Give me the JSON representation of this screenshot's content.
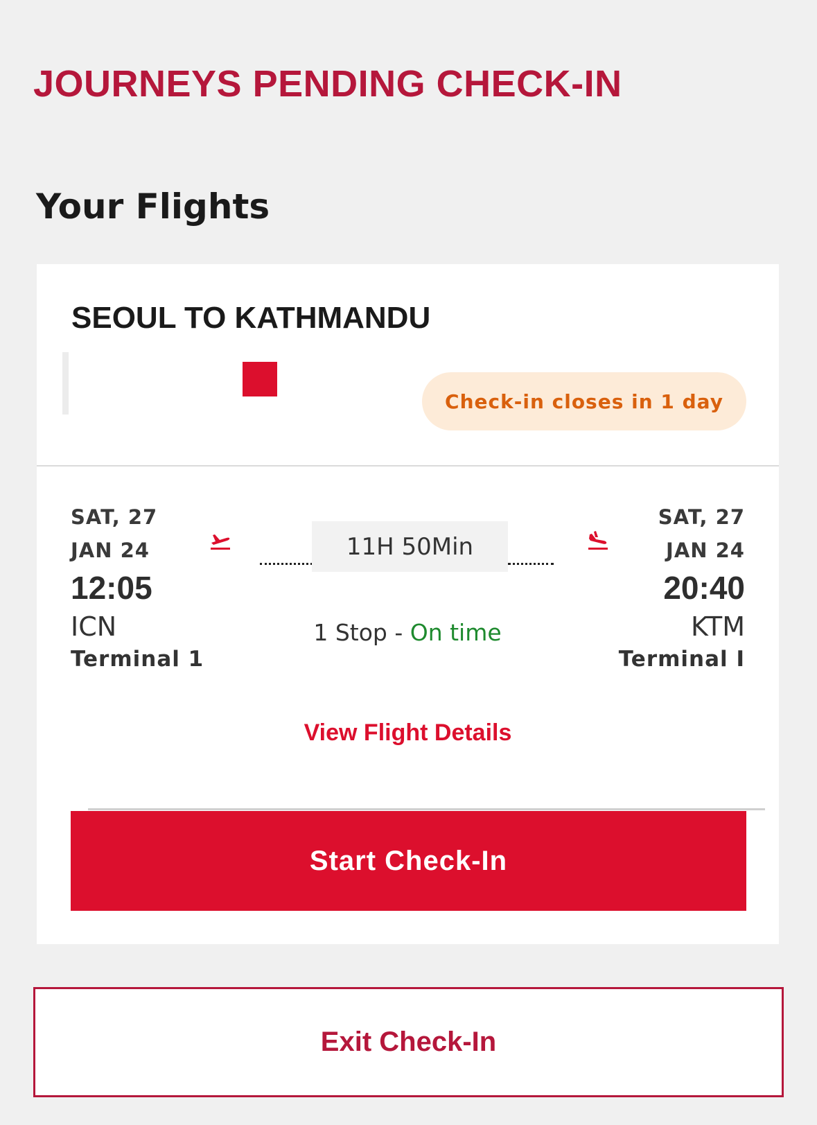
{
  "header": {
    "title": "JOURNEYS PENDING CHECK-IN",
    "section_title": "Your Flights"
  },
  "flight_card": {
    "route": "SEOUL TO KATHMANDU",
    "checkin_badge": "Check-in closes in 1 day",
    "departure": {
      "date_line1": "SAT, 27",
      "date_line2": "JAN 24",
      "time": "12:05",
      "airport": "ICN",
      "terminal": "Terminal 1"
    },
    "arrival": {
      "date_line1": "SAT, 27",
      "date_line2": "JAN 24",
      "time": "20:40",
      "airport": "KTM",
      "terminal": "Terminal I"
    },
    "duration": "11H 50Min",
    "stops": "1 Stop - ",
    "status": "On time",
    "view_details_label": "View Flight Details",
    "start_checkin_label": "Start Check-In"
  },
  "footer": {
    "exit_label": "Exit Check-In"
  },
  "colors": {
    "brand_red": "#dc0f2d",
    "title_red": "#b5173b",
    "badge_bg": "#fdebd8",
    "badge_text": "#d9600d",
    "on_time_green": "#1e8a2e"
  },
  "icons": {
    "takeoff": "plane-takeoff-icon",
    "landing": "plane-landing-icon"
  }
}
